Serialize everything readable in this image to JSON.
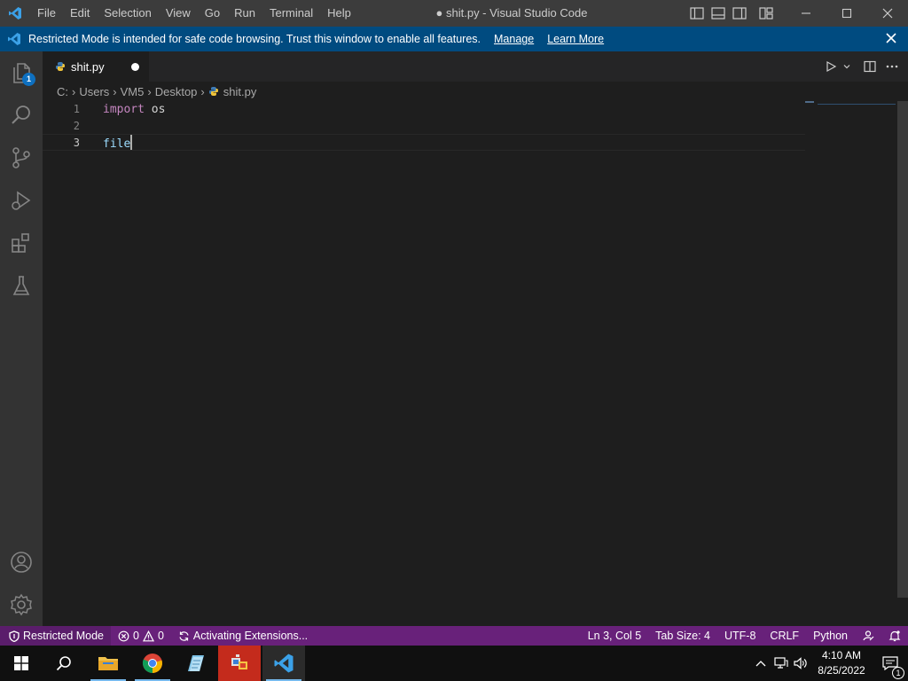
{
  "titlebar": {
    "menu": [
      "File",
      "Edit",
      "Selection",
      "View",
      "Go",
      "Run",
      "Terminal",
      "Help"
    ],
    "title": "● shit.py - Visual Studio Code"
  },
  "banner": {
    "text": "Restricted Mode is intended for safe code browsing. Trust this window to enable all features.",
    "manage": "Manage",
    "learn_more": "Learn More"
  },
  "activitybar": {
    "explorer_badge": "1",
    "items": [
      "explorer-icon",
      "search-icon",
      "source-control-icon",
      "run-debug-icon",
      "extensions-icon",
      "testing-icon"
    ],
    "bottom": [
      "accounts-icon",
      "settings-gear-icon"
    ]
  },
  "tab": {
    "name": "shit.py",
    "modified": true
  },
  "breadcrumbs": [
    "C:",
    "Users",
    "VM5",
    "Desktop",
    "shit.py"
  ],
  "code": {
    "lines": [
      {
        "number": "1",
        "keyword": "import",
        "rest": " os"
      },
      {
        "number": "2",
        "keyword": "",
        "rest": ""
      },
      {
        "number": "3",
        "keyword": "",
        "rest": "file"
      }
    ],
    "current_line": 3
  },
  "statusbar": {
    "restricted": "Restricted Mode",
    "errors": "0",
    "warnings": "0",
    "activating": "Activating Extensions...",
    "position": "Ln 3, Col 5",
    "tab_size": "Tab Size: 4",
    "encoding": "UTF-8",
    "eol": "CRLF",
    "language": "Python",
    "background_color": "#68217a"
  },
  "taskbar": {
    "time": "4:10 AM",
    "date": "8/25/2022",
    "notifications": "1"
  }
}
